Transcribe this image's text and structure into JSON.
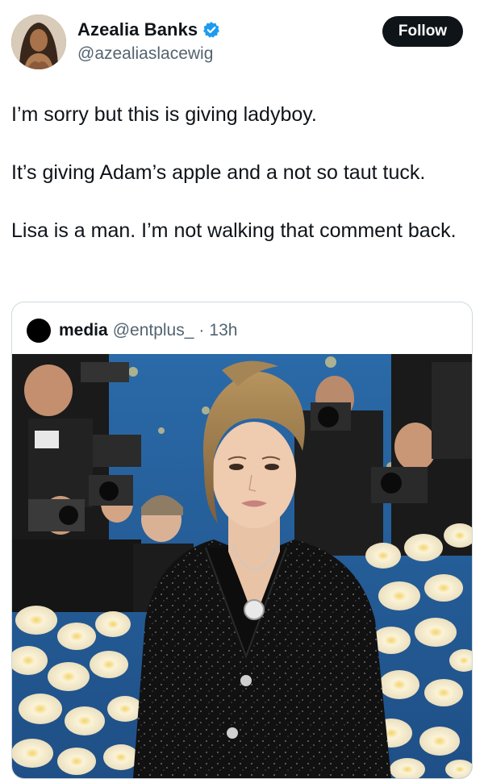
{
  "author": {
    "display_name": "Azealia Banks",
    "handle": "@azealiaslacewig",
    "verified_icon": "verified-badge-icon",
    "verified_color": "#1d9bf0"
  },
  "follow_button": {
    "label": "Follow"
  },
  "tweet": {
    "paragraphs": [
      "I’m sorry but this is giving ladyboy.",
      "It’s giving Adam’s apple and a not so taut tuck.",
      "Lisa is a man. I’m not walking that comment back."
    ]
  },
  "quoted_tweet": {
    "display_name": "media",
    "handle": "@entplus_",
    "separator": "·",
    "time": "13h"
  },
  "colors": {
    "text": "#0f1419",
    "secondary_text": "#536471",
    "border": "#cfd9de",
    "follow_bg": "#0f1419"
  }
}
